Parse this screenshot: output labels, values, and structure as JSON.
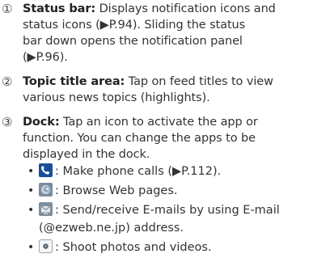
{
  "items": [
    {
      "number": "①",
      "term": "Status bar:",
      "lines": [
        " Displays notification icons and",
        "status icons (▶P.94). Sliding the status",
        "bar down opens the notification panel",
        "(▶P.96)."
      ]
    },
    {
      "number": "②",
      "term": "Topic title area:",
      "lines": [
        " Tap on feed titles to view",
        "various news topics (highlights)."
      ]
    },
    {
      "number": "③",
      "term": "Dock:",
      "lines": [
        " Tap an icon to activate the app or",
        "function. You can change the apps to be",
        "displayed in the dock."
      ],
      "bullets": [
        {
          "icon": "phone-icon",
          "text": ": Make phone calls (▶P.112)."
        },
        {
          "icon": "browser-icon",
          "text": ": Browse Web pages."
        },
        {
          "icon": "email-icon",
          "text": ": Send/receive E-mails by using E-mail",
          "continuation": "(@ezweb.ne.jp) address."
        },
        {
          "icon": "camera-icon",
          "text": ": Shoot photos and videos."
        }
      ]
    }
  ],
  "colors": {
    "text": "#333333",
    "phone_icon_bg": "#1a4f9c",
    "browser_icon_bg": "#7a8da0",
    "email_icon_bg": "#7d8f9c",
    "camera_icon_border": "#9aa4ad"
  }
}
